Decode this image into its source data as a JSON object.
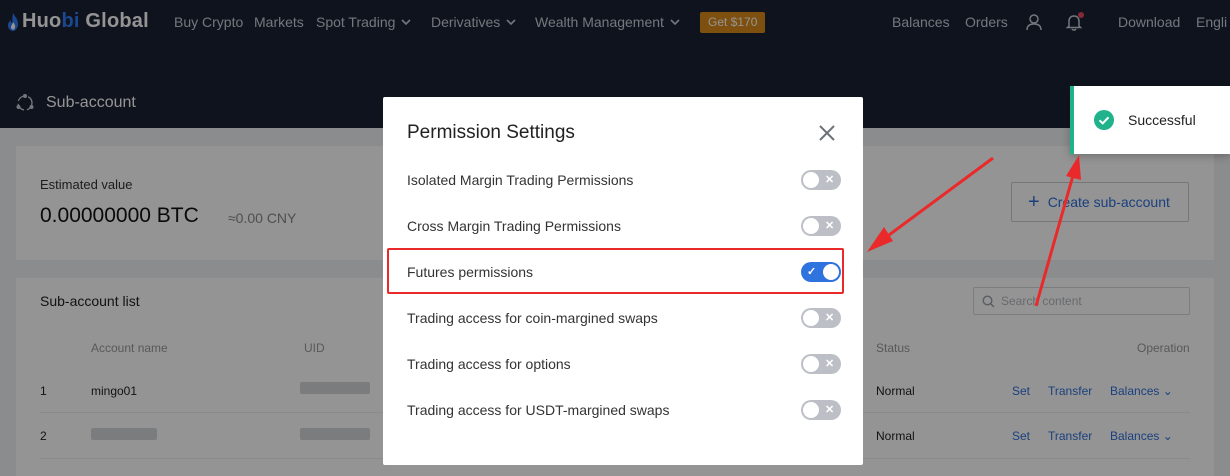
{
  "nav": {
    "logo_prefix": "Huo",
    "logo_bi": "bi",
    "logo_suffix": " Global",
    "items": [
      {
        "label": "Buy Crypto"
      },
      {
        "label": "Markets"
      },
      {
        "label": "Spot Trading"
      },
      {
        "label": "Derivatives"
      },
      {
        "label": "Wealth Management"
      }
    ],
    "promo": "Get $170",
    "right_items": [
      {
        "label": "Balances"
      },
      {
        "label": "Orders"
      },
      {
        "label": "Download"
      },
      {
        "label": "Engli"
      }
    ],
    "icons": [
      "user-icon",
      "bell-icon"
    ]
  },
  "subheader": {
    "title": "Sub-account",
    "icon": "sub-account-icon"
  },
  "overview": {
    "estimated_label": "Estimated value",
    "estimated_value": "0.00000000 BTC",
    "estimated_cny": "≈0.00 CNY",
    "create_button": "Create sub-account"
  },
  "list": {
    "title": "Sub-account list",
    "search_placeholder": "Search content",
    "columns": [
      "Account name",
      "UID",
      "Status",
      "Operation"
    ],
    "rows": [
      {
        "index": "1",
        "account": "mingo01",
        "status": "Normal",
        "actions": [
          "Set",
          "Transfer",
          "Balances"
        ]
      },
      {
        "index": "2",
        "account": "",
        "status": "Normal",
        "actions": [
          "Set",
          "Transfer",
          "Balances"
        ]
      }
    ]
  },
  "modal": {
    "title": "Permission Settings",
    "permissions": [
      {
        "label": "Isolated Margin Trading Permissions",
        "enabled": false
      },
      {
        "label": "Cross Margin Trading Permissions",
        "enabled": false
      },
      {
        "label": "Futures permissions",
        "enabled": true
      },
      {
        "label": "Trading access for coin-margined swaps",
        "enabled": false
      },
      {
        "label": "Trading access for options",
        "enabled": false
      },
      {
        "label": "Trading access for USDT-margined swaps",
        "enabled": false
      }
    ]
  },
  "toast": {
    "text": "Successful",
    "icon": "check-circle-icon",
    "color": "#1fb28b"
  },
  "colors": {
    "nav_bg": "#1b2233",
    "accent": "#2f73df",
    "promo": "#d98b1a",
    "annotation": "#ea2a2a"
  }
}
